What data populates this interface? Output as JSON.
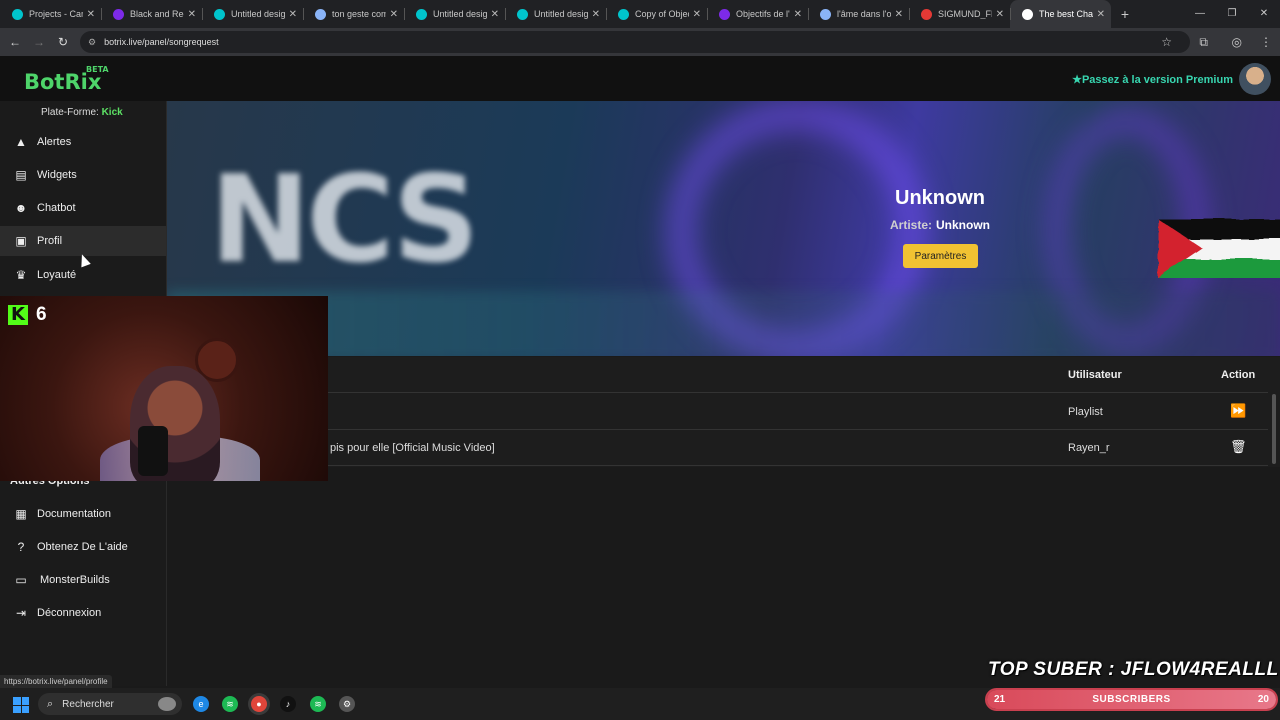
{
  "browser": {
    "tabs": [
      {
        "label": "Projects - Canva",
        "icon": "canva-icon",
        "color": "#00c4cc"
      },
      {
        "label": "Black and Red",
        "icon": "canva-icon",
        "color": "#7d2ae8"
      },
      {
        "label": "Untitled design",
        "icon": "canva-icon",
        "color": "#00c4cc"
      },
      {
        "label": "ton geste com",
        "icon": "doc-icon",
        "color": "#8ab4f8"
      },
      {
        "label": "Untitled design",
        "icon": "canva-icon",
        "color": "#00c4cc"
      },
      {
        "label": "Untitled design",
        "icon": "canva-icon",
        "color": "#00c4cc"
      },
      {
        "label": "Copy of Objec",
        "icon": "canva-icon",
        "color": "#00c4cc"
      },
      {
        "label": "Objectifs de l'e",
        "icon": "canva-icon",
        "color": "#7d2ae8"
      },
      {
        "label": "l'âme dans l'o",
        "icon": "page-icon",
        "color": "#8ab4f8"
      },
      {
        "label": "SIGMUND_FRE",
        "icon": "pdf-icon",
        "color": "#e53935"
      },
      {
        "label": "The best Chatb",
        "icon": "botrix-icon",
        "color": "#ffffff",
        "active": true
      }
    ],
    "new_tab": "+",
    "url": "botrix.live/panel/songrequest",
    "status_url": "https://botrix.live/panel/profile"
  },
  "app": {
    "logo": "BotRix",
    "logo_badge": "BETA",
    "premium_label": "Passez à la version Premium",
    "brand_color": "#4ed46a"
  },
  "sidebar": {
    "platform_label": "Plate-Forme:",
    "platform_value": "Kick",
    "items": [
      {
        "label": "Alertes",
        "icon": "warning-icon"
      },
      {
        "label": "Widgets",
        "icon": "table-icon"
      },
      {
        "label": "Chatbot",
        "icon": "robot-icon"
      },
      {
        "label": "Profil",
        "icon": "id-card-icon"
      },
      {
        "label": "Loyauté",
        "icon": "trophy-icon"
      }
    ],
    "section_title": "Autres Options",
    "other_items": [
      {
        "label": "Documentation",
        "icon": "book-icon"
      },
      {
        "label": "Obtenez De L'aide",
        "icon": "help-icon"
      },
      {
        "label": "MonsterBuilds",
        "icon": "laptop-icon"
      },
      {
        "label": "Déconnexion",
        "icon": "logout-icon"
      }
    ]
  },
  "player": {
    "cover_text": "NCS",
    "title": "Unknown",
    "artist_label": "Artiste:",
    "artist": "Unknown",
    "settings_button": "Paramètres"
  },
  "queue": {
    "headers": {
      "user": "Utilisateur",
      "action": "Action"
    },
    "rows": [
      {
        "title": "",
        "user": "Playlist",
        "action_icon": "skip-forward-icon"
      },
      {
        "title": "pis pour elle [Official Music Video]",
        "user": "Rayen_r",
        "action_icon": "trash-icon"
      }
    ]
  },
  "overlay": {
    "kick_count": "6",
    "top_suber": "TOP SUBER : JFLOW4REALLL",
    "sub_current": "21",
    "sub_label": "SUBSCRIBERS",
    "sub_goal": "20",
    "sub_progress": 1.0
  },
  "taskbar": {
    "search_placeholder": "Rechercher"
  }
}
